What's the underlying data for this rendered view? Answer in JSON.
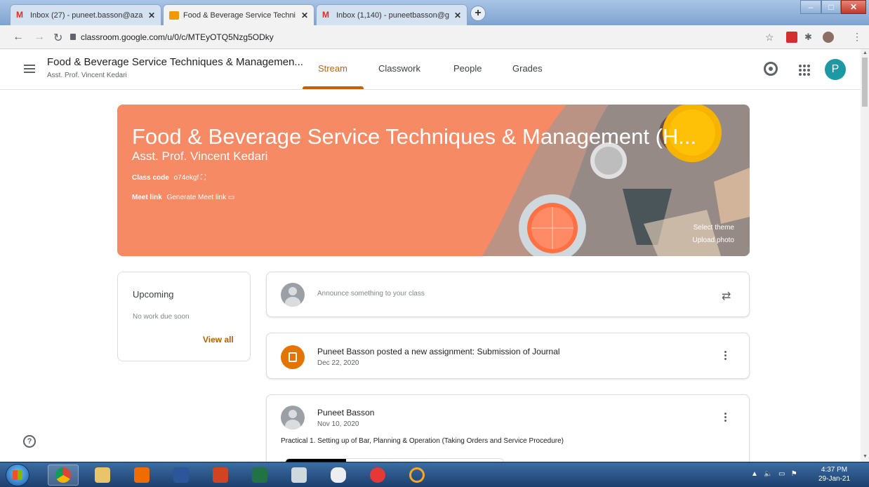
{
  "browser": {
    "tabs": [
      {
        "title": "Inbox (27) - puneet.basson@aza",
        "favicon": "gmail-icon",
        "active": false
      },
      {
        "title": "Food & Beverage Service Techni",
        "favicon": "classroom-icon",
        "active": true
      },
      {
        "title": "Inbox (1,140) - puneetbasson@g",
        "favicon": "gmail-icon",
        "active": false
      }
    ],
    "url": "classroom.google.com/u/0/c/MTEyOTQ5Nzg5ODky"
  },
  "header": {
    "class_name": "Food & Beverage Service Techniques & Managemen...",
    "teacher": "Asst. Prof. Vincent Kedari",
    "tabs": [
      "Stream",
      "Classwork",
      "People",
      "Grades"
    ],
    "active_tab": "Stream",
    "avatar_letter": "P"
  },
  "banner": {
    "title": "Food & Beverage Service Techniques & Management (H...",
    "teacher": "Asst. Prof. Vincent Kedari",
    "class_code_label": "Class code",
    "class_code": "o74ekgf",
    "meet_label": "Meet link",
    "meet_action": "Generate Meet link",
    "select_theme": "Select theme",
    "upload_photo": "Upload photo"
  },
  "upcoming": {
    "heading": "Upcoming",
    "status": "No work due soon",
    "view_all": "View all"
  },
  "stream": {
    "announce_placeholder": "Announce something to your class",
    "posts": [
      {
        "title": "Puneet Basson posted a new assignment: Submission of Journal",
        "date": "Dec 22, 2020"
      },
      {
        "author": "Puneet Basson",
        "date": "Nov 10, 2020",
        "body": "Practical 1. Setting up of Bar, Planning & Operation (Taking Orders and Service Procedure)"
      }
    ]
  },
  "taskbar": {
    "time": "4:37 PM",
    "date": "29-Jan-21"
  },
  "colors": {
    "banner": "#f58a64",
    "accent": "#c26401",
    "avatar": "#1b9aa6",
    "assignment_icon": "#e37400"
  }
}
